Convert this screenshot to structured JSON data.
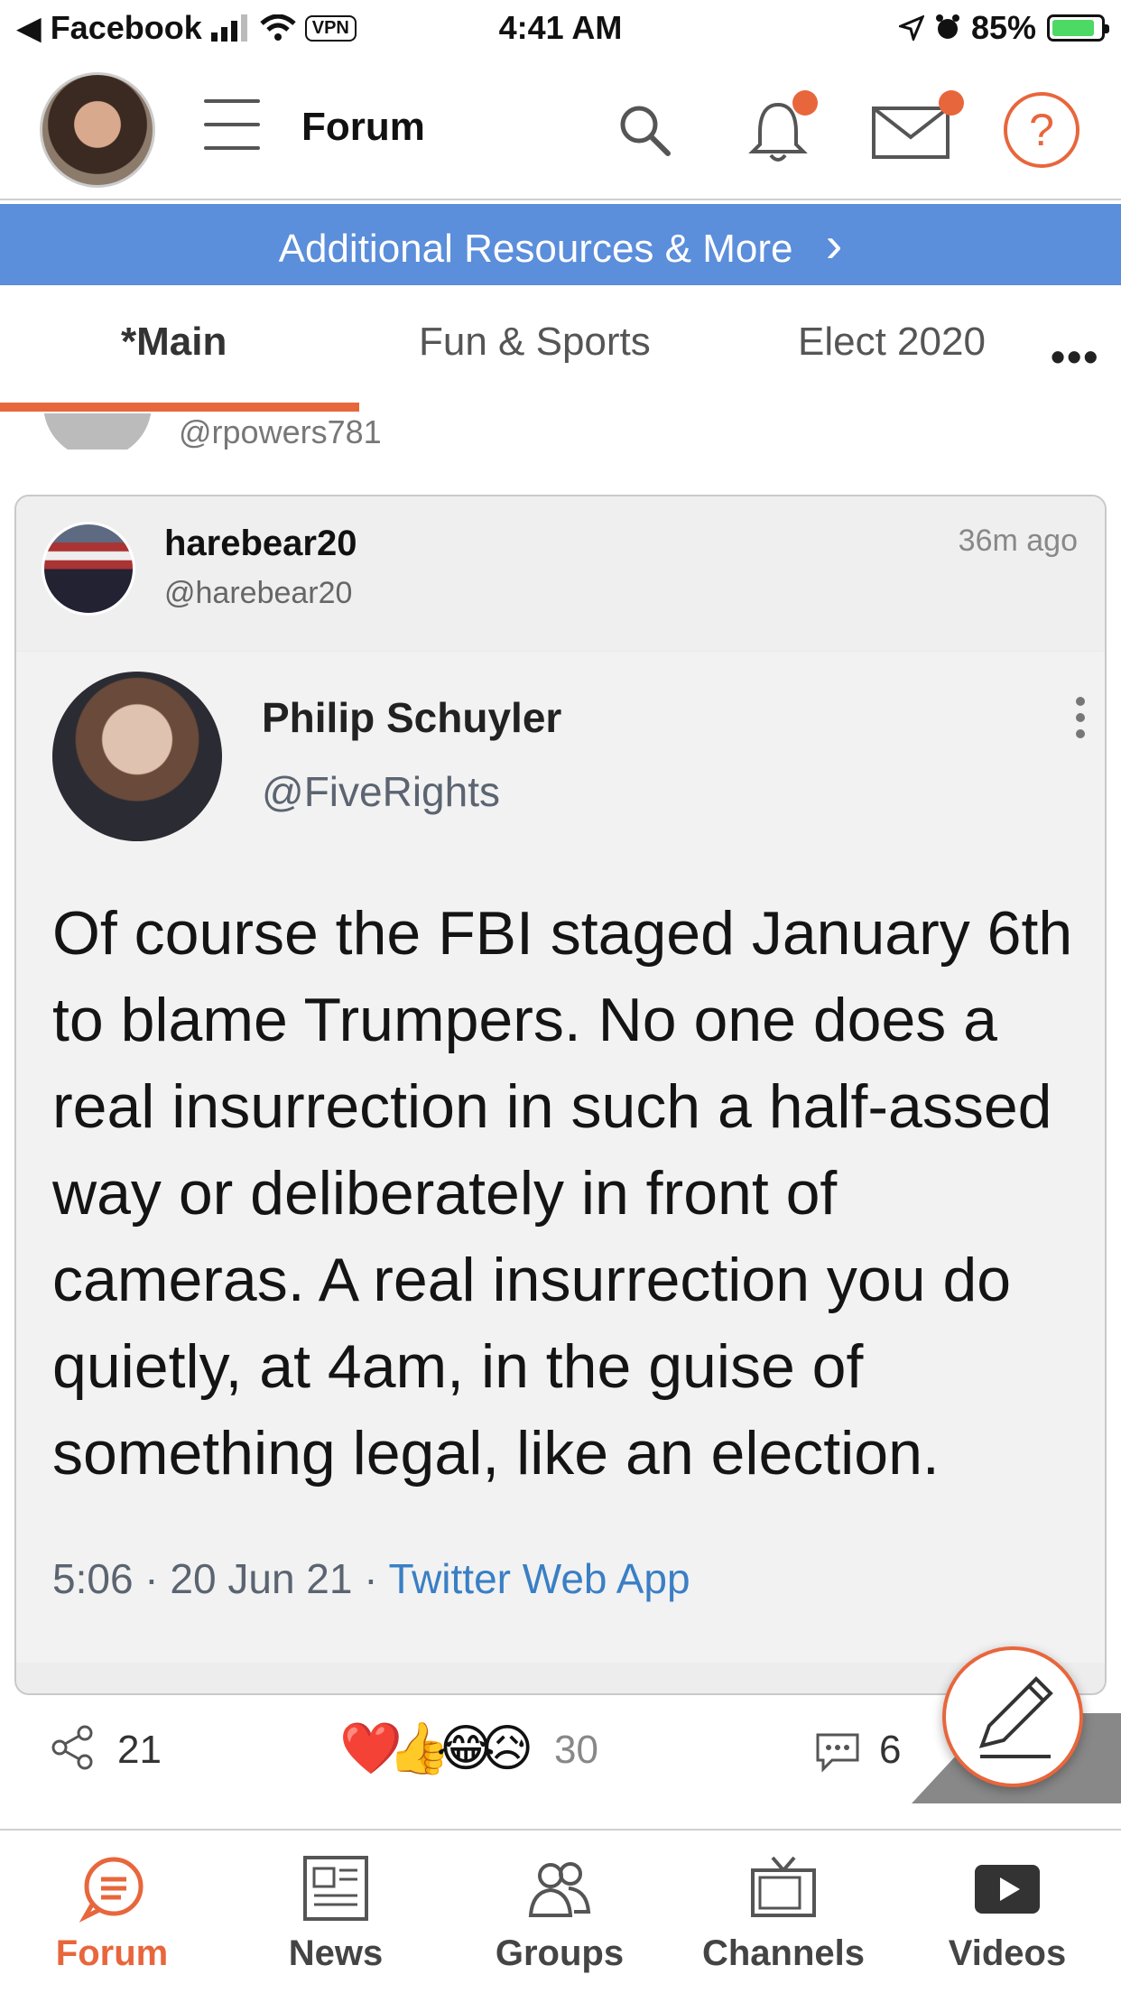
{
  "status_bar": {
    "back_app": "Facebook",
    "vpn": "VPN",
    "time": "4:41 AM",
    "battery": "85%"
  },
  "header": {
    "title": "Forum",
    "help_symbol": "?"
  },
  "banner": {
    "text": "Additional Resources & More",
    "chevron": "›"
  },
  "tabs": [
    {
      "label": "*Main",
      "active": true
    },
    {
      "label": "Fun & Sports",
      "active": false
    },
    {
      "label": "Elect 2020",
      "active": false
    }
  ],
  "tabs_more": "•••",
  "previous_post": {
    "handle": "@rpowers781"
  },
  "post": {
    "username": "harebear20",
    "handle": "@harebear20",
    "time_ago": "36m ago",
    "tweet": {
      "name": "Philip Schuyler",
      "handle": "@FiveRights",
      "text": "Of course the FBI staged January 6th to blame Trumpers. No one does a real insurrection in such a half-assed way or deliberately in front of cameras. A real insurrection you do quietly, at 4am, in the guise of something legal, like an election.",
      "meta_time": "5:06 · 20 Jun 21 · ",
      "meta_source": "Twitter Web App"
    }
  },
  "actions": {
    "share_count": "21",
    "reactions": "❤️👍😂😥",
    "reaction_count": "30",
    "comment_count": "6"
  },
  "bottom_nav": [
    {
      "label": "Forum",
      "icon": "forum-icon",
      "active": true
    },
    {
      "label": "News",
      "icon": "news-icon",
      "active": false
    },
    {
      "label": "Groups",
      "icon": "groups-icon",
      "active": false
    },
    {
      "label": "Channels",
      "icon": "tv-icon",
      "active": false
    },
    {
      "label": "Videos",
      "icon": "play-icon",
      "active": false
    }
  ],
  "colors": {
    "accent": "#e8663c",
    "banner": "#5b8edb",
    "link": "#3a7fc4"
  }
}
